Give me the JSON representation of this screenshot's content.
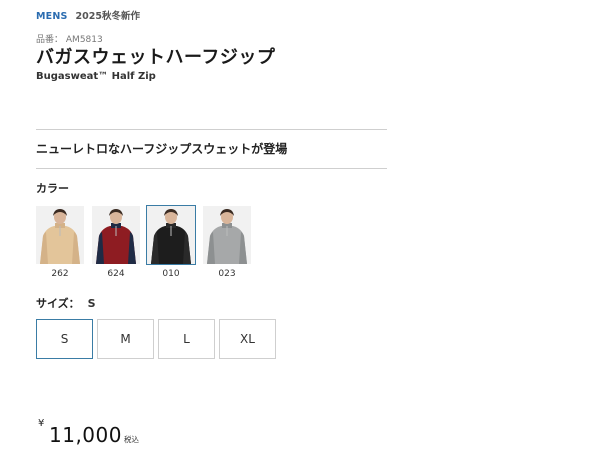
{
  "header": {
    "category_tag": "MENS",
    "season_tag": "2025秋冬新作"
  },
  "product": {
    "code_label": "品番：",
    "code": "AM5813",
    "name_ja": "バガスウェットハーフジップ",
    "name_en": "Bugasweat™ Half Zip",
    "catch_copy": "ニューレトロなハーフジップスウェットが登場"
  },
  "color_section": {
    "label": "カラー",
    "selected": "010",
    "options": [
      {
        "code": "262",
        "body_color": "#e3c59a",
        "trim_color": "#d4b288"
      },
      {
        "code": "624",
        "body_color": "#8e1c22",
        "trim_color": "#1f2b45"
      },
      {
        "code": "010",
        "body_color": "#1d1d1d",
        "trim_color": "#2a2a2a"
      },
      {
        "code": "023",
        "body_color": "#a6a8a9",
        "trim_color": "#8d9091"
      }
    ]
  },
  "size_section": {
    "label": "サイズ：",
    "selected": "S",
    "options": [
      "S",
      "M",
      "L",
      "XL"
    ]
  },
  "price": {
    "currency_symbol": "¥",
    "amount": "11,000",
    "tax_note": "税込"
  },
  "colors": {
    "accent": "#3a7ca5",
    "brand_blue": "#2b6cb0",
    "border": "#cfcfcf"
  }
}
